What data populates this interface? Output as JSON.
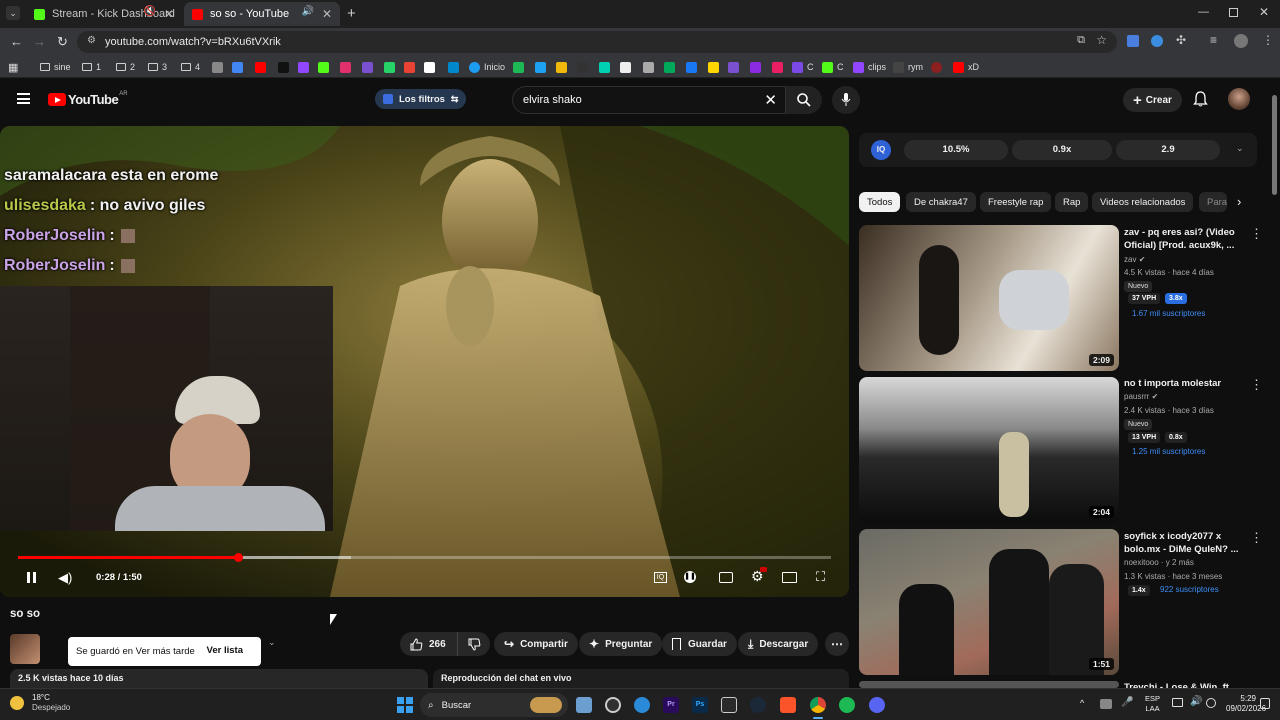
{
  "browser": {
    "tabs": [
      {
        "label": "Stream - Kick Dashboard",
        "active": false
      },
      {
        "label": "so so - YouTube",
        "active": true
      }
    ],
    "url": "youtube.com/watch?v=bRXu6tVXrik",
    "bookmarks": [
      "sine",
      "1",
      "2",
      "3",
      "4",
      "Inicio",
      "C",
      "C",
      "clips",
      "rym",
      "xD"
    ]
  },
  "youtube": {
    "logo_text": "YouTube",
    "logo_region": "AR",
    "filters_label": "Los filtros",
    "search_value": "elvira shako",
    "create_label": "Crear"
  },
  "stats_bar": {
    "values": [
      "10.5%",
      "0.9x",
      "2.9"
    ]
  },
  "chat_overlay": [
    {
      "user": "saramalacara esta en erome",
      "msg": "",
      "color": "#ffffff"
    },
    {
      "user": "ulisesdaka",
      "msg": ": no avivo giles",
      "color": "#b8c94a"
    },
    {
      "user": "RoberJoselin",
      "msg": ":",
      "color": "#c9a3e6"
    },
    {
      "user": "RoberJoselin",
      "msg": ":",
      "color": "#c9a3e6"
    }
  ],
  "player": {
    "time": "0:28 / 1:50",
    "progress": 0.27,
    "title": "so so"
  },
  "below_video": {
    "toast_text": "Se guardó en Ver más tarde",
    "toast_action": "Ver lista",
    "views": "2.5 K vistas  hace 10 días",
    "live_chat": "Reproducción del chat en vivo",
    "likes": "266",
    "share": "Compartir",
    "ask": "Preguntar",
    "save": "Guardar",
    "download": "Descargar"
  },
  "chips": [
    "Todos",
    "De chakra47",
    "Freestyle rap",
    "Rap",
    "Videos relacionados",
    "Para"
  ],
  "recommendations": [
    {
      "title": "zav - pq eres asi? (Video Oficial) [Prod. acux9k, ...",
      "channel": "zav",
      "meta": "4.5 K vistas · hace 4 días",
      "new": "Nuevo",
      "vph": "37 VPH",
      "ratio": "3.8x",
      "subs": "1.67 mil suscriptores",
      "duration": "2:09"
    },
    {
      "title": "no t importa molestar",
      "channel": "pausrrr",
      "meta": "2.4 K vistas · hace 3 días",
      "new": "Nuevo",
      "vph": "13 VPH",
      "ratio": "0.8x",
      "subs": "1.25 mil suscriptores",
      "duration": "2:04"
    },
    {
      "title": "soyfick x icody2077 x bolo.mx - DiMe QuIeN? ...",
      "channel": "noexitooo · y 2 más",
      "meta": "1.3 K vistas · hace 3 meses",
      "new": "",
      "vph": "1.4x",
      "ratio": "",
      "subs": "922 suscriptores",
      "duration": "1:51"
    },
    {
      "title": "Trevchi - Lose & Win, ft",
      "channel": "",
      "meta": "",
      "new": "",
      "vph": "",
      "ratio": "",
      "subs": "",
      "duration": ""
    }
  ],
  "taskbar": {
    "weather_temp": "18°C",
    "weather_desc": "Despejado",
    "search": "Buscar",
    "lang1": "ESP",
    "lang2": "LAA",
    "time": "5:29",
    "date": "09/02/2026"
  }
}
